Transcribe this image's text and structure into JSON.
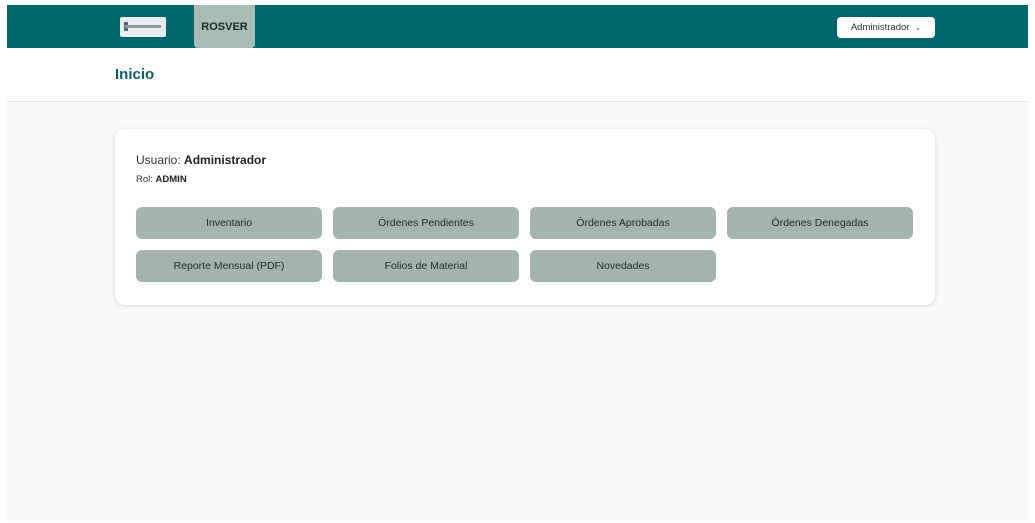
{
  "navbar": {
    "brand": "ROSVER",
    "user_menu": "Administrador",
    "user_menu_icon": "chevron-down-icon"
  },
  "page": {
    "title": "Inicio"
  },
  "user_info": {
    "user_label": "Usuario:",
    "user_name": "Administrador",
    "role_label": "Rol:",
    "role_value": "ADMIN"
  },
  "actions": [
    "Inventario",
    "Órdenes Pendientes",
    "Órdenes Aprobadas",
    "Órdenes Denegadas",
    "Reporte Mensual (PDF)",
    "Folios de Material",
    "Novedades"
  ],
  "colors": {
    "navbar": "#00676f",
    "brand_tab": "#a8bdb6",
    "button": "#a3b4ad",
    "title": "#0e5b61"
  }
}
